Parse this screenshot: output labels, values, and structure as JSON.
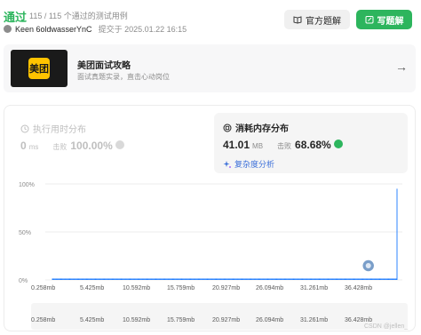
{
  "header": {
    "status": "通过",
    "summary": "115 / 115 个通过的测试用例",
    "username": "Keen 6oldwasserYnC",
    "submitted": "提交于 2025.01.22 16:15",
    "official_solution_label": "官方题解",
    "write_solution_label": "写题解"
  },
  "banner": {
    "logo_text": "美团",
    "title": "美团面试攻略",
    "subtitle": "面试真题实录，直击心动岗位"
  },
  "runtime": {
    "title": "执行用时分布",
    "value": "0",
    "unit": "ms",
    "beat_label": "击败",
    "beat_pct": "100.00%"
  },
  "memory": {
    "title": "消耗内存分布",
    "value": "41.01",
    "unit": "MB",
    "beat_label": "击败",
    "beat_pct": "68.68%",
    "analysis_label": "复杂度分析"
  },
  "chart_data": {
    "type": "bar",
    "y_ticks": [
      "100%",
      "50%",
      "0%"
    ],
    "ylim": [
      0,
      100
    ],
    "x_tick_labels": [
      "0.258mb",
      "5.425mb",
      "10.592mb",
      "15.759mb",
      "20.927mb",
      "26.094mb",
      "31.261mb",
      "36.428mb"
    ],
    "range_labels": [
      "0.258mb",
      "5.425mb",
      "10.592mb",
      "15.759mb",
      "20.927mb",
      "26.094mb",
      "31.261mb",
      "36.428mb"
    ],
    "series": [
      {
        "values": [
          1,
          1,
          1,
          1,
          1,
          1,
          1,
          1,
          1,
          1,
          1,
          1,
          1,
          1,
          1,
          1,
          1,
          1,
          1,
          1,
          1,
          1,
          1,
          1,
          1,
          1,
          1,
          1,
          1,
          1,
          1,
          1,
          1,
          1,
          1,
          1,
          1,
          1,
          1,
          1,
          1,
          1,
          1,
          1,
          1,
          1,
          1,
          1,
          1,
          1,
          1,
          1,
          1,
          1,
          1,
          1,
          1,
          1,
          1,
          1,
          1,
          1,
          1,
          1,
          1,
          1,
          1,
          1,
          1,
          1,
          1,
          1,
          1,
          1,
          1,
          1,
          1,
          1,
          1,
          1,
          1,
          1,
          1,
          1,
          1,
          1,
          1,
          1,
          1,
          1,
          1,
          1,
          1,
          1,
          1,
          1,
          1,
          1,
          1,
          1,
          1,
          1,
          1,
          1,
          1,
          1,
          1,
          1,
          1,
          1,
          1,
          1,
          1,
          1,
          1,
          1,
          1,
          1,
          1,
          1,
          1,
          1,
          1,
          1,
          1,
          1,
          1,
          1,
          1,
          1,
          1,
          1,
          1,
          1,
          1,
          1,
          1,
          1,
          1,
          1,
          1,
          1,
          1,
          1,
          1,
          1,
          1,
          1,
          1,
          1,
          1,
          1,
          1,
          1,
          1,
          1,
          1,
          1,
          1,
          1,
          1,
          1,
          1,
          1,
          1,
          1,
          1,
          1,
          1,
          1,
          1,
          1,
          1,
          1,
          1,
          1,
          1,
          1,
          1,
          1,
          1,
          1,
          1,
          1,
          1,
          1,
          1,
          1,
          1,
          1,
          1,
          1,
          1,
          1,
          1,
          1,
          1,
          1,
          1,
          1,
          1,
          1,
          1,
          1,
          1,
          1,
          1,
          1,
          1,
          1,
          1,
          1,
          1,
          1,
          1,
          1,
          1,
          1,
          1,
          1,
          1,
          1,
          1,
          1,
          1,
          1,
          1,
          1,
          1,
          1,
          1,
          1,
          1,
          1,
          1,
          1,
          1,
          1,
          1,
          1,
          1,
          1,
          1,
          1,
          1,
          1,
          1,
          1,
          1,
          1,
          1,
          1,
          1,
          1,
          1,
          1,
          1,
          1,
          1,
          1,
          1,
          1,
          1,
          1,
          1,
          1,
          1,
          1,
          1,
          1,
          1,
          1,
          1,
          1,
          1,
          1,
          1,
          1,
          1,
          1,
          1,
          1,
          1,
          1,
          1,
          1,
          1,
          1,
          1,
          1,
          1,
          1,
          1,
          1,
          1,
          1,
          1,
          1,
          1,
          1,
          1,
          1,
          1,
          1,
          1,
          1,
          1,
          1,
          1,
          1,
          1,
          1,
          1,
          1,
          1,
          1,
          1,
          1,
          1,
          1,
          1,
          1,
          1,
          1,
          1,
          1,
          1,
          1,
          1,
          1,
          1,
          1,
          1,
          1,
          1,
          1,
          1,
          1,
          1,
          1,
          1,
          1,
          1,
          1,
          1,
          1,
          1,
          1,
          1,
          1,
          1,
          1,
          1,
          1,
          1,
          1,
          1,
          1,
          1,
          1,
          1,
          1,
          1,
          1,
          1,
          1,
          1,
          1,
          1,
          1,
          1,
          1,
          1,
          1,
          1,
          1,
          1,
          1,
          1,
          1,
          1,
          1,
          1,
          1,
          1,
          1,
          1,
          1,
          1,
          1,
          1,
          1,
          1,
          1,
          1,
          1,
          1,
          1,
          1,
          1,
          1,
          1,
          1,
          1,
          1,
          1,
          1,
          1,
          1,
          1,
          1,
          1,
          1,
          1,
          1,
          1,
          1,
          1,
          1,
          1,
          1,
          1,
          1,
          1,
          1,
          1,
          1,
          1,
          95
        ]
      }
    ],
    "highlighted_index": 399,
    "bar_color": "#1677ff",
    "grid": true
  },
  "watermark": "CSDN @jellen_",
  "colors": {
    "accent_green": "#2db55d",
    "bar_blue": "#1677ff",
    "link_blue": "#3b6fd9"
  }
}
